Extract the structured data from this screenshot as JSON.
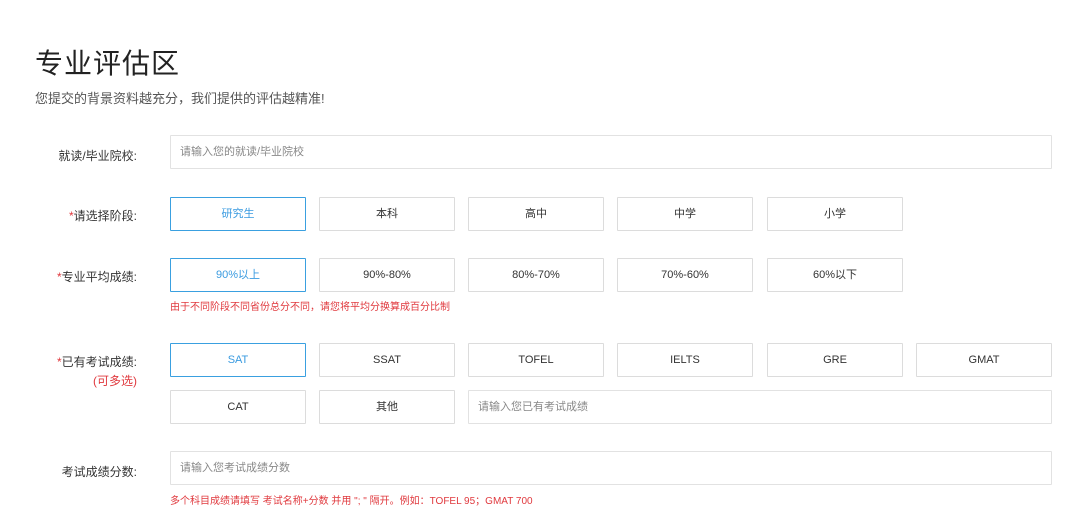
{
  "header": {
    "title": "专业评估区",
    "subtitle": "您提交的背景资料越充分，我们提供的评估越精准!"
  },
  "school": {
    "label": "就读/毕业院校:",
    "placeholder": "请输入您的就读/毕业院校",
    "value": ""
  },
  "stage": {
    "required_mark": "*",
    "label": "请选择阶段:",
    "options": [
      "研究生",
      "本科",
      "高中",
      "中学",
      "小学"
    ],
    "selected": "研究生"
  },
  "gpa": {
    "required_mark": "*",
    "label": "专业平均成绩:",
    "options": [
      "90%以上",
      "90%-80%",
      "80%-70%",
      "70%-60%",
      "60%以下"
    ],
    "selected": "90%以上",
    "hint": "由于不同阶段不同省份总分不同，请您将平均分换算成百分比制"
  },
  "exams": {
    "required_mark": "*",
    "label": "已有考试成绩:",
    "sublabel": "(可多选)",
    "options": [
      "SAT",
      "SSAT",
      "TOFEL",
      "IELTS",
      "GRE",
      "GMAT",
      "CAT",
      "其他"
    ],
    "selected": "SAT",
    "other_placeholder": "请输入您已有考试成绩"
  },
  "score": {
    "label": "考试成绩分数:",
    "placeholder": "请输入您考试成绩分数",
    "hint": "多个科目成绩请填写 考试名称+分数 并用 \"; \" 隔开。例如：TOFEL 95；GMAT 700"
  },
  "colors": {
    "accent": "#3a9be0",
    "required": "#e0393e",
    "border": "#dcdcdc"
  }
}
